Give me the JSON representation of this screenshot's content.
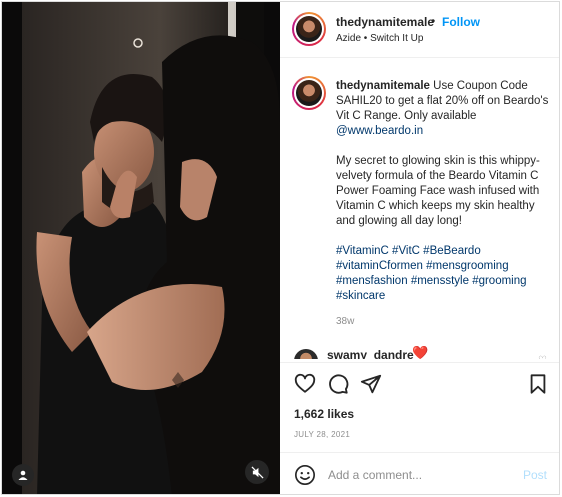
{
  "header": {
    "username": "thedynamitemale",
    "separator": "•",
    "follow_label": "Follow",
    "audio_line": "Azide • Switch It Up"
  },
  "caption": {
    "username": "thedynamitemale",
    "text_1": "Use Coupon Code SAHIL20 to get a flat 20% off on Beardo's Vit C Range. Only available ",
    "mention": "@www.beardo.in",
    "text_2": "My secret to glowing skin is this whippy-velvety formula of the Beardo Vitamin C Power Foaming Face wash infused with Vitamin C which keeps my skin healthy and glowing all day long!",
    "hashtags": [
      "#VitaminC",
      "#VitC",
      "#BeBeardo",
      "#vitaminCformen",
      "#mensgrooming",
      "#mensfashion",
      "#mensstyle",
      "#grooming",
      "#skincare"
    ],
    "time_ago": "38w"
  },
  "comment_preview": {
    "username": "swamy_dandre",
    "hearts": "❤️❤️"
  },
  "actions": {
    "like_icon": "heart-outline-icon",
    "comment_icon": "comment-bubble-icon",
    "share_icon": "paper-plane-icon",
    "save_icon": "bookmark-icon"
  },
  "likes_label": "1,662 likes",
  "date_label": "JULY 28, 2021",
  "comment_box": {
    "placeholder": "Add a comment...",
    "post_label": "Post"
  },
  "media": {
    "user_tag_icon": "user-tag-icon",
    "mute_icon": "muted-speaker-icon"
  },
  "colors": {
    "link": "#00376b",
    "follow": "#0095f6",
    "post_disabled": "#b2dffc",
    "muted_text": "#8e8e8e"
  }
}
